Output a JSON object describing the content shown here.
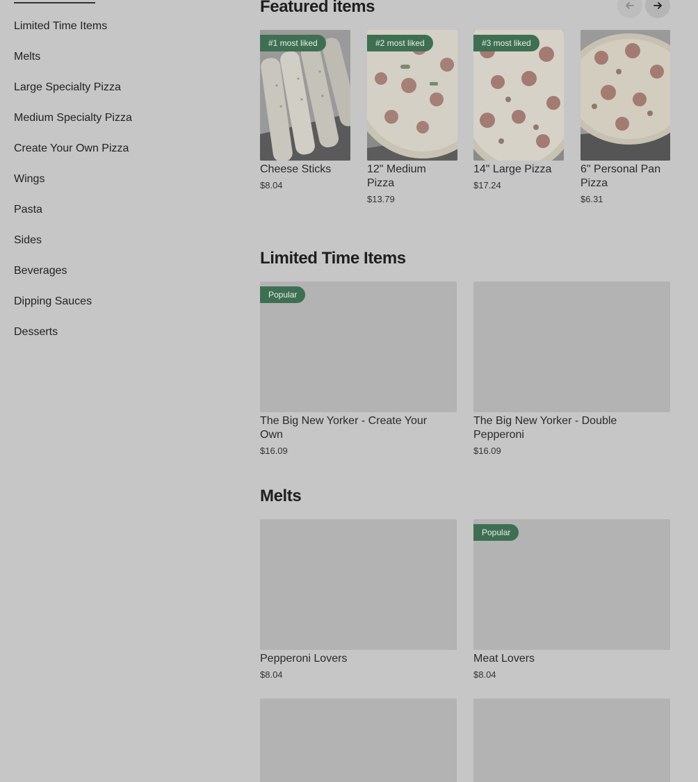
{
  "sidebar": {
    "items": [
      {
        "label": "Limited Time Items"
      },
      {
        "label": "Melts"
      },
      {
        "label": "Large Specialty Pizza"
      },
      {
        "label": "Medium Specialty Pizza"
      },
      {
        "label": "Create Your Own Pizza"
      },
      {
        "label": "Wings"
      },
      {
        "label": "Pasta"
      },
      {
        "label": "Sides"
      },
      {
        "label": "Beverages"
      },
      {
        "label": "Dipping Sauces"
      },
      {
        "label": "Desserts"
      }
    ]
  },
  "featured": {
    "title": "Featured items",
    "prev_icon": "arrow-left-icon",
    "next_icon": "arrow-right-icon",
    "items": [
      {
        "badge": "#1 most liked",
        "name": "Cheese Sticks",
        "price": "$8.04"
      },
      {
        "badge": "#2 most liked",
        "name": "12\" Medium Pizza",
        "price": "$13.79"
      },
      {
        "badge": "#3 most liked",
        "name": "14\" Large Pizza",
        "price": "$17.24"
      },
      {
        "badge": "",
        "name": "6\" Personal Pan Pizza",
        "price": "$6.31"
      }
    ]
  },
  "limited": {
    "title": "Limited Time Items",
    "items": [
      {
        "badge": "Popular",
        "name": "The Big New Yorker - Create Your Own",
        "price": "$16.09"
      },
      {
        "badge": "",
        "name": "The Big New Yorker - Double Pepperoni",
        "price": "$16.09"
      }
    ]
  },
  "melts": {
    "title": "Melts",
    "items": [
      {
        "badge": "",
        "name": "Pepperoni Lovers",
        "price": "$8.04"
      },
      {
        "badge": "Popular",
        "name": "Meat Lovers",
        "price": "$8.04"
      }
    ]
  },
  "colors": {
    "overlay_bg": "#c6c6c6",
    "badge_bg": "#3f6f52",
    "placeholder": "#b3b3b3"
  }
}
